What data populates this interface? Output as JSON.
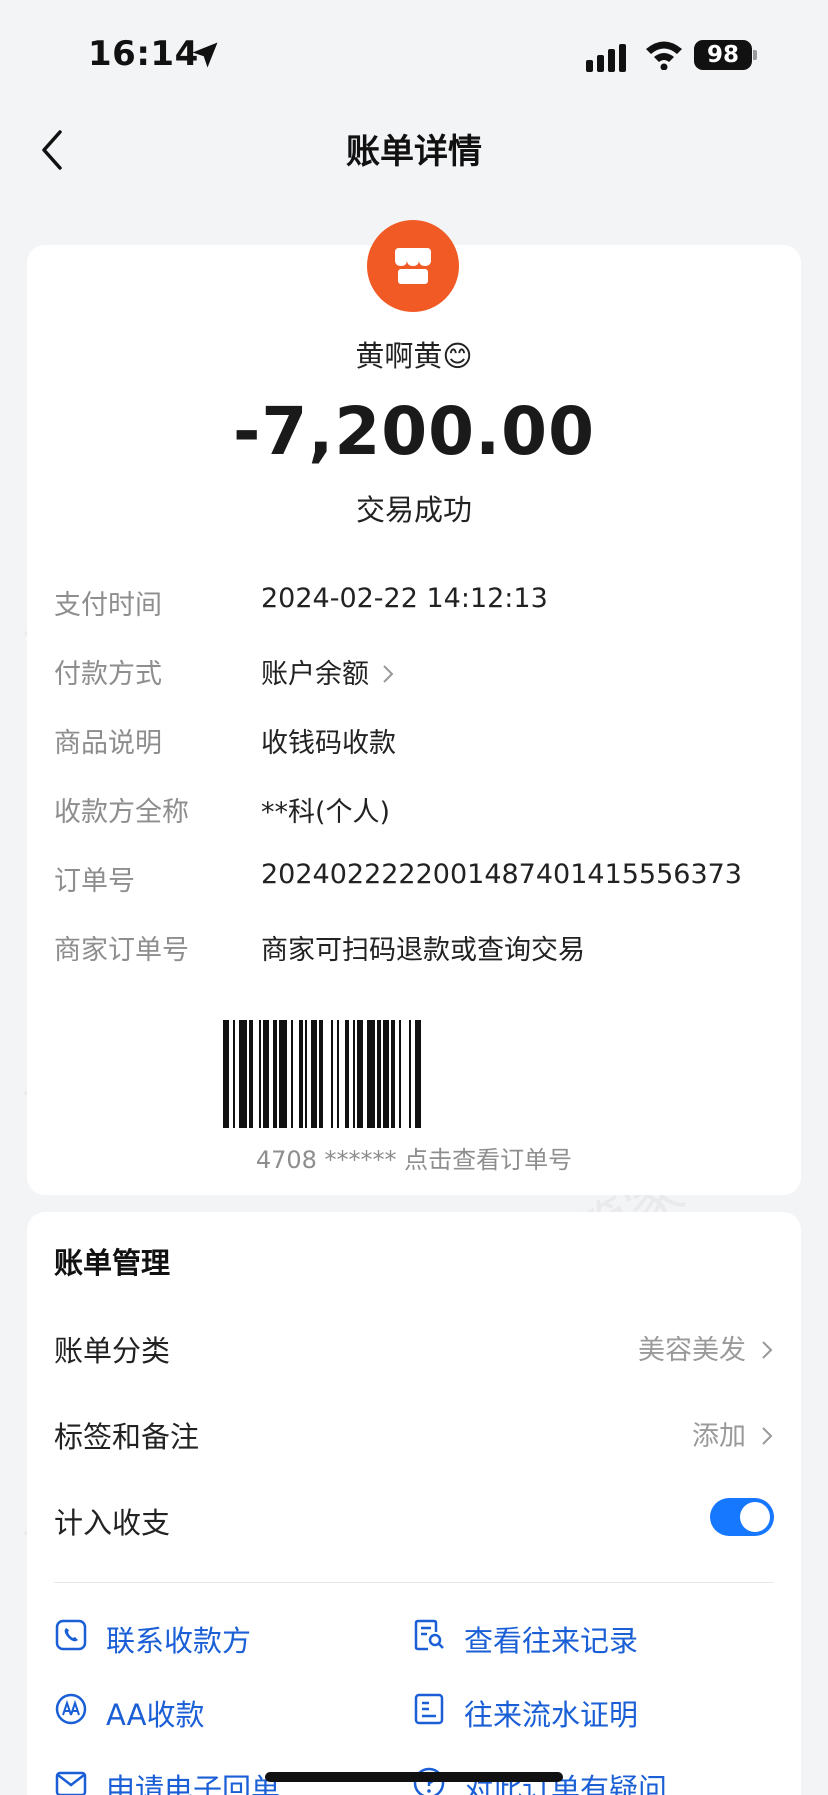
{
  "status_bar": {
    "time": "16:14",
    "battery": "98"
  },
  "nav": {
    "title": "账单详情"
  },
  "transaction": {
    "payee": "黄啊黄😊",
    "amount": "-7,200.00",
    "status": "交易成功"
  },
  "details": [
    {
      "label": "支付时间",
      "value": "2024-02-22 14:12:13"
    },
    {
      "label": "付款方式",
      "value": "账户余额"
    },
    {
      "label": "商品说明",
      "value": "收钱码收款"
    },
    {
      "label": "收款方全称",
      "value": "**科(个人)"
    },
    {
      "label": "订单号",
      "value": "2024022222001487401415556373"
    },
    {
      "label": "商家订单号",
      "value": "商家可扫码退款或查询交易"
    }
  ],
  "barcode": {
    "caption": "4708 ****** 点击查看订单号"
  },
  "management": {
    "title": "账单管理",
    "category": {
      "label": "账单分类",
      "value": "美容美发"
    },
    "tags": {
      "label": "标签和备注",
      "value": "添加"
    },
    "include": {
      "label": "计入收支",
      "enabled": true
    }
  },
  "actions": {
    "contact": "联系收款方",
    "history": "查看往来记录",
    "aa": "AA收款",
    "statement": "往来流水证明",
    "receipt": "申请电子回单",
    "question": "对此订单有疑问"
  },
  "watermark": "消费保 您身边的消费服务管家",
  "colors": {
    "accent": "#1677ff",
    "link": "#1a5fd6",
    "avatar": "#f15a24"
  },
  "icons": [
    "location-arrow-icon",
    "signal-icon",
    "wifi-icon",
    "battery-icon",
    "back-arrow-icon",
    "store-icon",
    "chevron-right-icon",
    "phone-icon",
    "records-icon",
    "aa-icon",
    "statement-icon",
    "mail-icon",
    "question-icon"
  ]
}
